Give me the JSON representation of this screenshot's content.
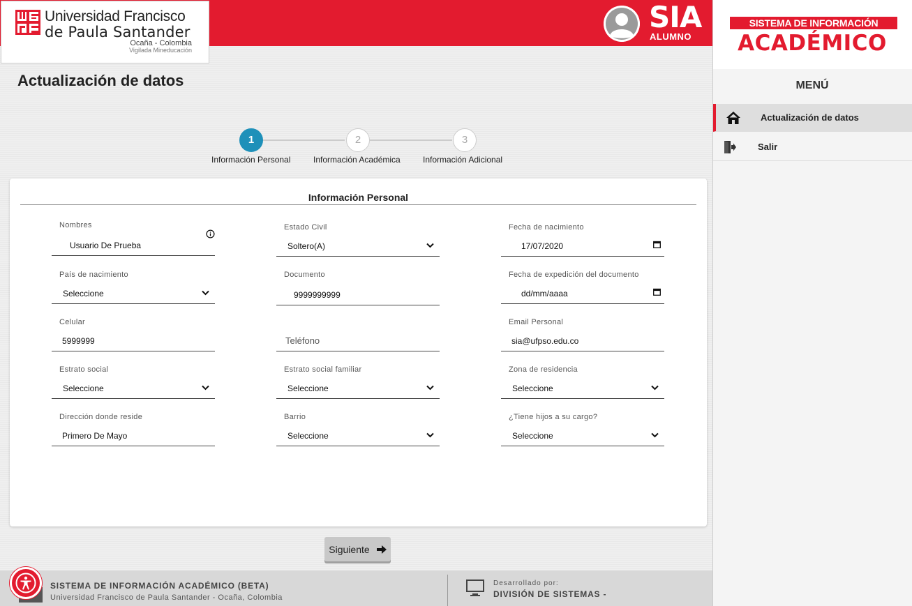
{
  "header": {
    "university_line1": "Universidad Francisco",
    "university_line2": "de Paula Santander",
    "location": "Ocaña - Colombia",
    "vigilada": "Vigilada Mineducación",
    "app_title": "SIA",
    "app_subtitle": "ALUMNO",
    "brand_color": "#e31b2f"
  },
  "page": {
    "title": "Actualización de datos"
  },
  "stepper": {
    "steps": [
      {
        "number": "1",
        "label": "Información Personal",
        "active": true
      },
      {
        "number": "2",
        "label": "Información Académica",
        "active": false
      },
      {
        "number": "3",
        "label": "Información Adicional",
        "active": false
      }
    ],
    "active_color": "#1e90b9"
  },
  "form": {
    "title": "Información Personal",
    "fields": {
      "nombres": {
        "label": "Nombres",
        "value": "Usuario De Prueba"
      },
      "estado_civil": {
        "label": "Estado Civil",
        "value": "Soltero(A)"
      },
      "fecha_nacimiento": {
        "label": "Fecha de nacimiento",
        "value": "17/07/2020"
      },
      "pais_nacimiento": {
        "label": "País de nacimiento",
        "value": "Seleccione"
      },
      "documento": {
        "label": "Documento",
        "value": "9999999999"
      },
      "fecha_expedicion": {
        "label": "Fecha de expedición del documento",
        "value": "dd/mm/aaaa"
      },
      "celular": {
        "label": "Celular",
        "value": "5999999"
      },
      "telefono": {
        "label": "",
        "placeholder": "Teléfono"
      },
      "email": {
        "label": "Email Personal",
        "value": "sia@ufpso.edu.co"
      },
      "estrato": {
        "label": "Estrato social",
        "value": "Seleccione"
      },
      "estrato_familiar": {
        "label": "Estrato social familiar",
        "value": "Seleccione"
      },
      "zona": {
        "label": "Zona de residencia",
        "value": "Seleccione"
      },
      "direccion": {
        "label": "Dirección donde reside",
        "value": "Primero De Mayo"
      },
      "barrio": {
        "label": "Barrio",
        "value": "Seleccione"
      },
      "hijos": {
        "label": "¿Tiene hijos a su cargo?",
        "value": "Seleccione"
      }
    },
    "next_label": "Siguiente"
  },
  "sidebar": {
    "system_label": "SISTEMA DE INFORMACIÓN",
    "system_name": "ACADÉMICO",
    "menu_title": "MENÚ",
    "items": [
      {
        "label": "Actualización de datos",
        "icon": "home-icon",
        "active": true
      },
      {
        "label": "Salir",
        "icon": "exit-icon",
        "active": false
      }
    ]
  },
  "footer": {
    "title": "SISTEMA DE INFORMACIÓN ACADÉMICO (BETA)",
    "subtitle": "Universidad Francisco de Paula Santander - Ocaña, Colombia",
    "dev_label": "Desarrollado por:",
    "dev_value": "DIVISIÓN DE SISTEMAS -"
  }
}
